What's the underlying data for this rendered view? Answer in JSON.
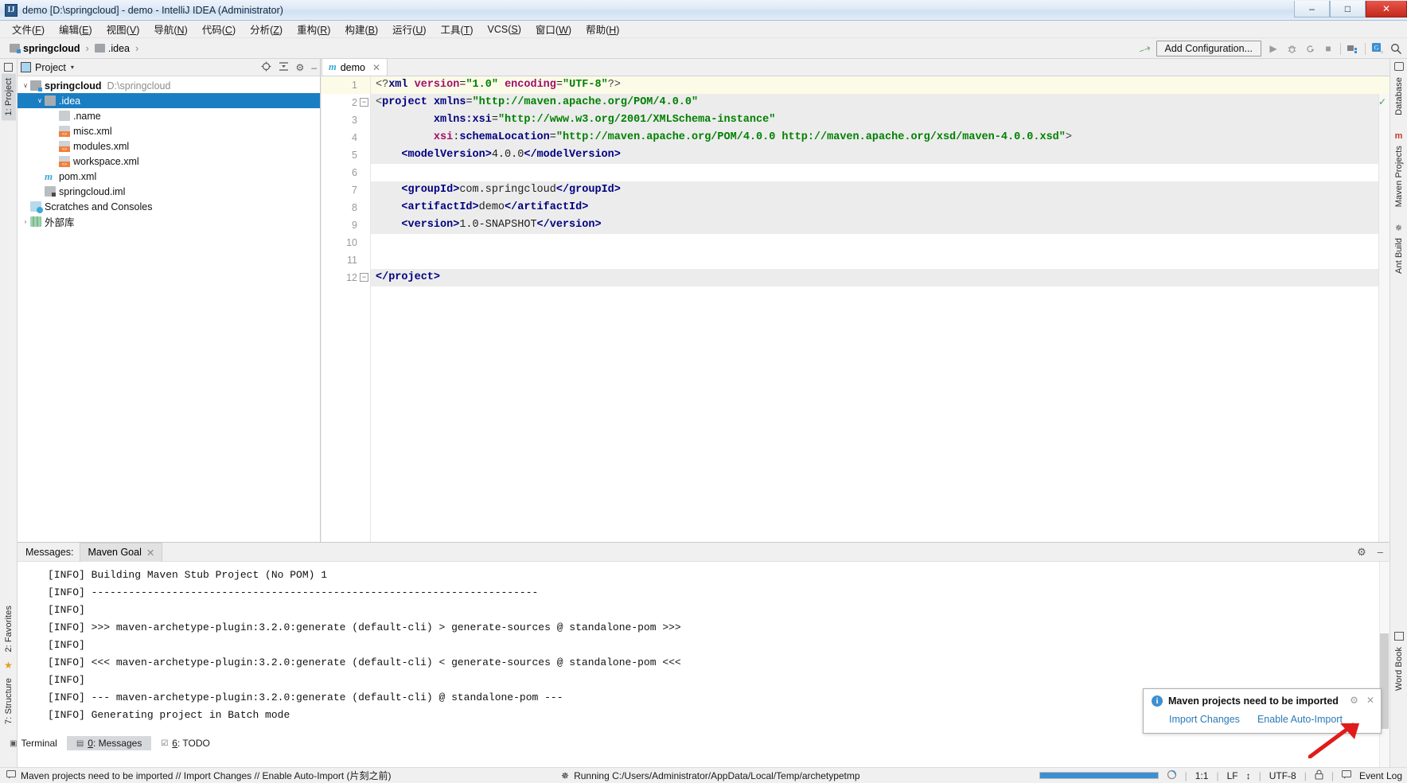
{
  "window": {
    "title": "demo [D:\\springcloud] - demo - IntelliJ IDEA (Administrator)",
    "app_icon": "IJ",
    "minimize": "–",
    "maximize": "□",
    "close": "✕"
  },
  "menubar": [
    {
      "label": "文件(F)"
    },
    {
      "label": "编辑(E)"
    },
    {
      "label": "视图(V)"
    },
    {
      "label": "导航(N)"
    },
    {
      "label": "代码(C)"
    },
    {
      "label": "分析(Z)"
    },
    {
      "label": "重构(R)"
    },
    {
      "label": "构建(B)"
    },
    {
      "label": "运行(U)"
    },
    {
      "label": "工具(T)"
    },
    {
      "label": "VCS(S)"
    },
    {
      "label": "窗口(W)"
    },
    {
      "label": "帮助(H)"
    }
  ],
  "navbar": {
    "breadcrumb": [
      {
        "label": "springcloud",
        "icon": "project-folder-icon"
      },
      {
        "label": ".idea",
        "icon": "folder-icon"
      }
    ],
    "separator": "›",
    "add_configuration": "Add Configuration...",
    "hammer_icon": "build-hammer-icon",
    "run_icon": "▶",
    "debug_icon": "🐞",
    "run_coverage_icon": "⟳",
    "stop_icon": "■",
    "project_structure_icon": "project-structure-icon",
    "translate_icon": "G",
    "search_icon": "⌕"
  },
  "left_rail": [
    {
      "label": "1: Project",
      "selected": true
    },
    {
      "label": "2: Favorites",
      "selected": false
    },
    {
      "label": "7: Structure",
      "selected": false
    }
  ],
  "right_rail": [
    {
      "label": "Database"
    },
    {
      "label": "Maven Projects"
    },
    {
      "label": "Ant Build"
    },
    {
      "label": "Word Book"
    }
  ],
  "project_panel": {
    "title": "Project",
    "caret": "▾",
    "actions": [
      "locate-icon",
      "collapse-all-icon",
      "settings-gear-icon",
      "hide-icon"
    ],
    "tree": [
      {
        "label": "springcloud",
        "path": "D:\\springcloud",
        "indent": 0,
        "arrow": "∨",
        "icon": "project-folder-icon",
        "bold": true,
        "selected": false
      },
      {
        "label": ".idea",
        "path": "",
        "indent": 1,
        "arrow": "∨",
        "icon": "folder-icon",
        "bold": false,
        "selected": true
      },
      {
        "label": ".name",
        "path": "",
        "indent": 2,
        "arrow": "",
        "icon": "file-icon",
        "bold": false,
        "selected": false
      },
      {
        "label": "misc.xml",
        "path": "",
        "indent": 2,
        "arrow": "",
        "icon": "xml-file-icon",
        "bold": false,
        "selected": false
      },
      {
        "label": "modules.xml",
        "path": "",
        "indent": 2,
        "arrow": "",
        "icon": "xml-file-icon",
        "bold": false,
        "selected": false
      },
      {
        "label": "workspace.xml",
        "path": "",
        "indent": 2,
        "arrow": "",
        "icon": "xml-file-icon",
        "bold": false,
        "selected": false
      },
      {
        "label": "pom.xml",
        "path": "",
        "indent": 1,
        "arrow": "",
        "icon": "maven-file-icon",
        "bold": false,
        "selected": false
      },
      {
        "label": "springcloud.iml",
        "path": "",
        "indent": 1,
        "arrow": "",
        "icon": "iml-file-icon",
        "bold": false,
        "selected": false
      },
      {
        "label": "Scratches and Consoles",
        "path": "",
        "indent": 0,
        "arrow": "",
        "icon": "scratches-icon",
        "bold": false,
        "selected": false
      },
      {
        "label": "外部库",
        "path": "",
        "indent": 0,
        "arrow": "›",
        "icon": "library-icon",
        "bold": false,
        "selected": false
      }
    ]
  },
  "editor": {
    "tab": {
      "label": "demo",
      "icon": "maven-file-icon",
      "close": "✕"
    },
    "inspection_mark": "✓",
    "lines": [
      {
        "n": "1",
        "fold": "",
        "current": true,
        "parts": [
          {
            "t": "<?",
            "c": "chev"
          },
          {
            "t": "xml",
            "c": "pi"
          },
          {
            "t": " ",
            "c": "txt"
          },
          {
            "t": "version",
            "c": "attr"
          },
          {
            "t": "=",
            "c": "txt"
          },
          {
            "t": "\"1.0\"",
            "c": "str"
          },
          {
            "t": " ",
            "c": "txt"
          },
          {
            "t": "encoding",
            "c": "attr"
          },
          {
            "t": "=",
            "c": "txt"
          },
          {
            "t": "\"UTF-8\"",
            "c": "str"
          },
          {
            "t": "?>",
            "c": "chev"
          }
        ],
        "text": "<?xml version=\"1.0\" encoding=\"UTF-8\"?>"
      },
      {
        "n": "2",
        "fold": "−",
        "current": false,
        "parts": [
          {
            "t": "<",
            "c": "chev"
          },
          {
            "t": "project",
            "c": "tag"
          },
          {
            "t": " ",
            "c": "txt"
          },
          {
            "t": "xmlns",
            "c": "tag"
          },
          {
            "t": "=",
            "c": "txt"
          },
          {
            "t": "\"http://maven.apache.org/POM/4.0.0\"",
            "c": "str"
          }
        ],
        "text": "<project xmlns=\"http://maven.apache.org/POM/4.0.0\""
      },
      {
        "n": "3",
        "fold": "",
        "current": false,
        "parts": [
          {
            "t": "         ",
            "c": "txt"
          },
          {
            "t": "xmlns:xsi",
            "c": "tag"
          },
          {
            "t": "=",
            "c": "txt"
          },
          {
            "t": "\"http://www.w3.org/2001/XMLSchema-instance\"",
            "c": "str"
          }
        ],
        "text": "         xmlns:xsi=\"http://www.w3.org/2001/XMLSchema-instance\""
      },
      {
        "n": "4",
        "fold": "",
        "current": false,
        "parts": [
          {
            "t": "         ",
            "c": "txt"
          },
          {
            "t": "xsi",
            "c": "attr"
          },
          {
            "t": ":",
            "c": "txt"
          },
          {
            "t": "schemaLocation",
            "c": "tag"
          },
          {
            "t": "=",
            "c": "txt"
          },
          {
            "t": "\"http://maven.apache.org/POM/4.0.0 http://maven.apache.org/xsd/maven-4.0.0.xsd\"",
            "c": "str"
          },
          {
            "t": ">",
            "c": "chev"
          }
        ],
        "text": "         xsi:schemaLocation=\"http://maven.apache.org/POM/4.0.0 http://maven.apache.org/xsd/maven-4.0.0.xsd\">"
      },
      {
        "n": "5",
        "fold": "",
        "current": false,
        "parts": [
          {
            "t": "    ",
            "c": "txt"
          },
          {
            "t": "<modelVersion>",
            "c": "tag"
          },
          {
            "t": "4.0.0",
            "c": "txt"
          },
          {
            "t": "</modelVersion>",
            "c": "tag"
          }
        ],
        "text": "    <modelVersion>4.0.0</modelVersion>"
      },
      {
        "n": "6",
        "fold": "",
        "current": false,
        "parts": [],
        "text": ""
      },
      {
        "n": "7",
        "fold": "",
        "current": false,
        "parts": [
          {
            "t": "    ",
            "c": "txt"
          },
          {
            "t": "<groupId>",
            "c": "tag"
          },
          {
            "t": "com.springcloud",
            "c": "txt"
          },
          {
            "t": "</groupId>",
            "c": "tag"
          }
        ],
        "text": "    <groupId>com.springcloud</groupId>"
      },
      {
        "n": "8",
        "fold": "",
        "current": false,
        "parts": [
          {
            "t": "    ",
            "c": "txt"
          },
          {
            "t": "<artifactId>",
            "c": "tag"
          },
          {
            "t": "demo",
            "c": "txt"
          },
          {
            "t": "</artifactId>",
            "c": "tag"
          }
        ],
        "text": "    <artifactId>demo</artifactId>"
      },
      {
        "n": "9",
        "fold": "",
        "current": false,
        "parts": [
          {
            "t": "    ",
            "c": "txt"
          },
          {
            "t": "<version>",
            "c": "tag"
          },
          {
            "t": "1.0-SNAPSHOT",
            "c": "txt"
          },
          {
            "t": "</version>",
            "c": "tag"
          }
        ],
        "text": "    <version>1.0-SNAPSHOT</version>"
      },
      {
        "n": "10",
        "fold": "",
        "current": false,
        "parts": [],
        "text": ""
      },
      {
        "n": "11",
        "fold": "",
        "current": false,
        "parts": [],
        "text": ""
      },
      {
        "n": "12",
        "fold": "−",
        "current": false,
        "parts": [
          {
            "t": "</project>",
            "c": "tag"
          }
        ],
        "text": "</project>"
      }
    ]
  },
  "bottom_panel": {
    "label": "Messages:",
    "tab": {
      "label": "Maven Goal",
      "close": "✕"
    },
    "actions": [
      "settings-gear-icon",
      "hide-icon"
    ],
    "log": [
      "[INFO] Building Maven Stub Project (No POM) 1",
      "[INFO] ------------------------------------------------------------------------",
      "[INFO]",
      "[INFO] >>> maven-archetype-plugin:3.2.0:generate (default-cli) > generate-sources @ standalone-pom >>>",
      "[INFO]",
      "[INFO] <<< maven-archetype-plugin:3.2.0:generate (default-cli) < generate-sources @ standalone-pom <<<",
      "[INFO]",
      "[INFO] --- maven-archetype-plugin:3.2.0:generate (default-cli) @ standalone-pom ---",
      "[INFO] Generating project in Batch mode"
    ]
  },
  "tool_tabs": [
    {
      "label": "Terminal",
      "icon": "terminal-icon",
      "selected": false
    },
    {
      "label": "0: Messages",
      "icon": "messages-icon",
      "selected": true
    },
    {
      "label": "6: TODO",
      "icon": "todo-icon",
      "selected": false
    }
  ],
  "notification": {
    "title": "Maven projects need to be imported",
    "info_icon": "info-icon",
    "actions": [
      {
        "label": "Import Changes"
      },
      {
        "label": "Enable Auto-Import"
      }
    ],
    "settings_icon": "gear-icon",
    "close_icon": "✕",
    "arrow_annotation": "red-arrow-annotation"
  },
  "statusbar": {
    "message": "Maven projects need to be imported // Import Changes // Enable Auto-Import (片刻之前)",
    "message_icon": "balloon-icon",
    "running": "Running C:/Users/Administrator/AppData/Local/Temp/archetypetmp",
    "running_icon": "gear-spin-icon",
    "caret_position": "1:1",
    "line_separator": "LF",
    "encoding": "UTF-8",
    "lock_icon": "lock-icon",
    "event_log": "Event Log",
    "event_log_icon": "event-log-icon",
    "progress_percent": 100,
    "separator": "↕"
  },
  "colors": {
    "selection_blue": "#1a7ec2",
    "link_blue": "#2a7ab9",
    "xml_tag": "#000080",
    "xml_string": "#008000",
    "xml_attr": "#9e1068",
    "annotation_red": "#e01b1b",
    "xml_icon_orange": "#f0803c"
  }
}
